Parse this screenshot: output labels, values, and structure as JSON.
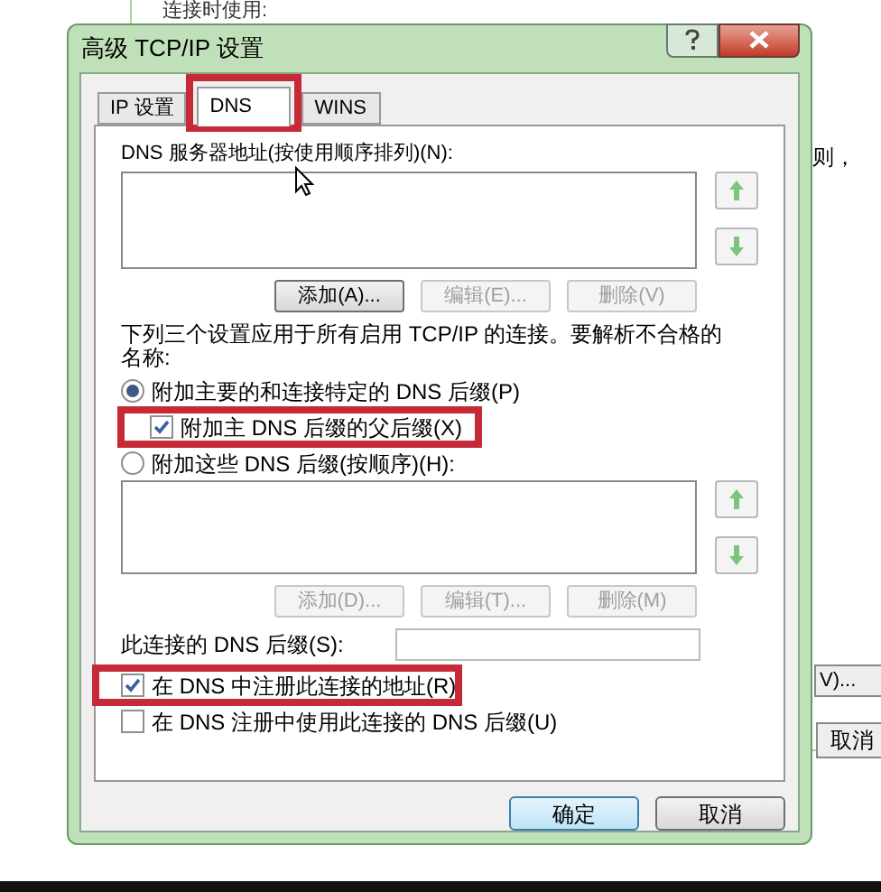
{
  "background_window": {
    "top_text": "连接时使用:",
    "side_text": "则，",
    "side_button": "V)...",
    "cancel_button": "取消"
  },
  "dialog": {
    "title": "高级 TCP/IP 设置"
  },
  "tabs": [
    {
      "label": "IP 设置",
      "selected": false
    },
    {
      "label": "DNS",
      "selected": true
    },
    {
      "label": "WINS",
      "selected": false
    }
  ],
  "dns_servers": {
    "label": "DNS 服务器地址(按使用顺序排列)(N):",
    "buttons": [
      {
        "label": "添加(A)...",
        "disabled": false
      },
      {
        "label": "编辑(E)...",
        "disabled": true
      },
      {
        "label": "删除(V)",
        "disabled": true
      }
    ]
  },
  "resolution_note": "下列三个设置应用于所有启用 TCP/IP 的连接。要解析不合格的名称:",
  "resolution_modes": [
    {
      "label": "附加主要的和连接特定的 DNS 后缀(P)",
      "selected": true,
      "sub_option": {
        "label": "附加主 DNS 后缀的父后缀(X)",
        "checked": true
      }
    },
    {
      "label": "附加这些 DNS 后缀(按顺序)(H):",
      "selected": false
    }
  ],
  "suffix_list": {
    "buttons": [
      {
        "label": "添加(D)...",
        "disabled": true
      },
      {
        "label": "编辑(T)...",
        "disabled": true
      },
      {
        "label": "删除(M)",
        "disabled": true
      }
    ]
  },
  "connection_suffix": {
    "label": "此连接的 DNS 后缀(S):"
  },
  "registration": [
    {
      "label": "在 DNS 中注册此连接的地址(R)",
      "checked": true
    },
    {
      "label": "在 DNS 注册中使用此连接的 DNS 后缀(U)",
      "checked": false
    }
  ],
  "footer_buttons": [
    "确定",
    "取消"
  ]
}
